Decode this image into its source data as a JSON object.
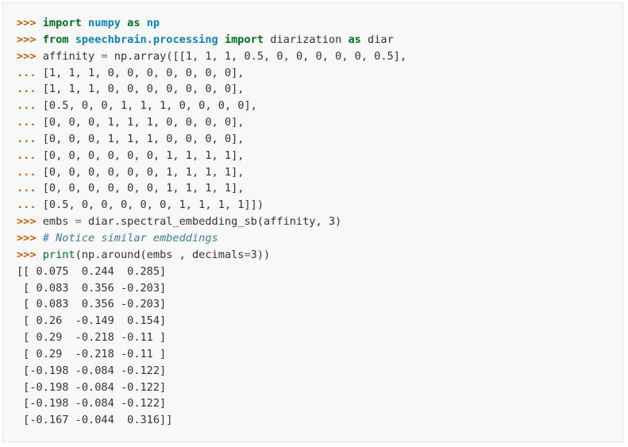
{
  "code": {
    "prompt_primary": ">>>",
    "prompt_continuation": "...",
    "lines": [
      {
        "kind": "input",
        "tokens": [
          {
            "c": "kn",
            "t": "import"
          },
          {
            "c": "plain",
            "t": " "
          },
          {
            "c": "nn",
            "t": "numpy"
          },
          {
            "c": "plain",
            "t": " "
          },
          {
            "c": "k",
            "t": "as"
          },
          {
            "c": "plain",
            "t": " "
          },
          {
            "c": "nn",
            "t": "np"
          }
        ]
      },
      {
        "kind": "input",
        "tokens": [
          {
            "c": "kn",
            "t": "from"
          },
          {
            "c": "plain",
            "t": " "
          },
          {
            "c": "nn",
            "t": "speechbrain.processing"
          },
          {
            "c": "plain",
            "t": " "
          },
          {
            "c": "kn",
            "t": "import"
          },
          {
            "c": "plain",
            "t": " diarization "
          },
          {
            "c": "k",
            "t": "as"
          },
          {
            "c": "plain",
            "t": " diar"
          }
        ]
      },
      {
        "kind": "input",
        "tokens": [
          {
            "c": "plain",
            "t": "affinity "
          },
          {
            "c": "o",
            "t": "="
          },
          {
            "c": "plain",
            "t": " np.array([[1, 1, 1, 0.5, 0, 0, 0, 0, 0, 0.5],"
          }
        ]
      },
      {
        "kind": "cont",
        "tokens": [
          {
            "c": "plain",
            "t": "[1, 1, 1, 0, 0, 0, 0, 0, 0, 0],"
          }
        ]
      },
      {
        "kind": "cont",
        "tokens": [
          {
            "c": "plain",
            "t": "[1, 1, 1, 0, 0, 0, 0, 0, 0, 0],"
          }
        ]
      },
      {
        "kind": "cont",
        "tokens": [
          {
            "c": "plain",
            "t": "[0.5, 0, 0, 1, 1, 1, 0, 0, 0, 0],"
          }
        ]
      },
      {
        "kind": "cont",
        "tokens": [
          {
            "c": "plain",
            "t": "[0, 0, 0, 1, 1, 1, 0, 0, 0, 0],"
          }
        ]
      },
      {
        "kind": "cont",
        "tokens": [
          {
            "c": "plain",
            "t": "[0, 0, 0, 1, 1, 1, 0, 0, 0, 0],"
          }
        ]
      },
      {
        "kind": "cont",
        "tokens": [
          {
            "c": "plain",
            "t": "[0, 0, 0, 0, 0, 0, 1, 1, 1, 1],"
          }
        ]
      },
      {
        "kind": "cont",
        "tokens": [
          {
            "c": "plain",
            "t": "[0, 0, 0, 0, 0, 0, 1, 1, 1, 1],"
          }
        ]
      },
      {
        "kind": "cont",
        "tokens": [
          {
            "c": "plain",
            "t": "[0, 0, 0, 0, 0, 0, 1, 1, 1, 1],"
          }
        ]
      },
      {
        "kind": "cont",
        "tokens": [
          {
            "c": "plain",
            "t": "[0.5, 0, 0, 0, 0, 0, 1, 1, 1, 1]])"
          }
        ]
      },
      {
        "kind": "input",
        "tokens": [
          {
            "c": "plain",
            "t": "embs "
          },
          {
            "c": "o",
            "t": "="
          },
          {
            "c": "plain",
            "t": " diar.spectral_embedding_sb(affinity, 3)"
          }
        ]
      },
      {
        "kind": "input",
        "tokens": [
          {
            "c": "c1",
            "t": "# Notice similar embeddings"
          }
        ]
      },
      {
        "kind": "input",
        "tokens": [
          {
            "c": "nb",
            "t": "print"
          },
          {
            "c": "plain",
            "t": "(np.around(embs , decimals"
          },
          {
            "c": "o",
            "t": "="
          },
          {
            "c": "plain",
            "t": "3))"
          }
        ]
      },
      {
        "kind": "output",
        "tokens": [
          {
            "c": "go",
            "t": "[[ 0.075  0.244  0.285]"
          }
        ]
      },
      {
        "kind": "output",
        "tokens": [
          {
            "c": "go",
            "t": " [ 0.083  0.356 -0.203]"
          }
        ]
      },
      {
        "kind": "output",
        "tokens": [
          {
            "c": "go",
            "t": " [ 0.083  0.356 -0.203]"
          }
        ]
      },
      {
        "kind": "output",
        "tokens": [
          {
            "c": "go",
            "t": " [ 0.26  -0.149  0.154]"
          }
        ]
      },
      {
        "kind": "output",
        "tokens": [
          {
            "c": "go",
            "t": " [ 0.29  -0.218 -0.11 ]"
          }
        ]
      },
      {
        "kind": "output",
        "tokens": [
          {
            "c": "go",
            "t": " [ 0.29  -0.218 -0.11 ]"
          }
        ]
      },
      {
        "kind": "output",
        "tokens": [
          {
            "c": "go",
            "t": " [-0.198 -0.084 -0.122]"
          }
        ]
      },
      {
        "kind": "output",
        "tokens": [
          {
            "c": "go",
            "t": " [-0.198 -0.084 -0.122]"
          }
        ]
      },
      {
        "kind": "output",
        "tokens": [
          {
            "c": "go",
            "t": " [-0.198 -0.084 -0.122]"
          }
        ]
      },
      {
        "kind": "output",
        "tokens": [
          {
            "c": "go",
            "t": " [-0.167 -0.044  0.316]]"
          }
        ]
      }
    ]
  },
  "colors": {
    "background": "#f8f8f8",
    "border": "#e1e4e5",
    "prompt": "#c65d09",
    "keyword": "#007020",
    "module": "#0e84b5",
    "comment": "#408090",
    "number": "#208050"
  }
}
